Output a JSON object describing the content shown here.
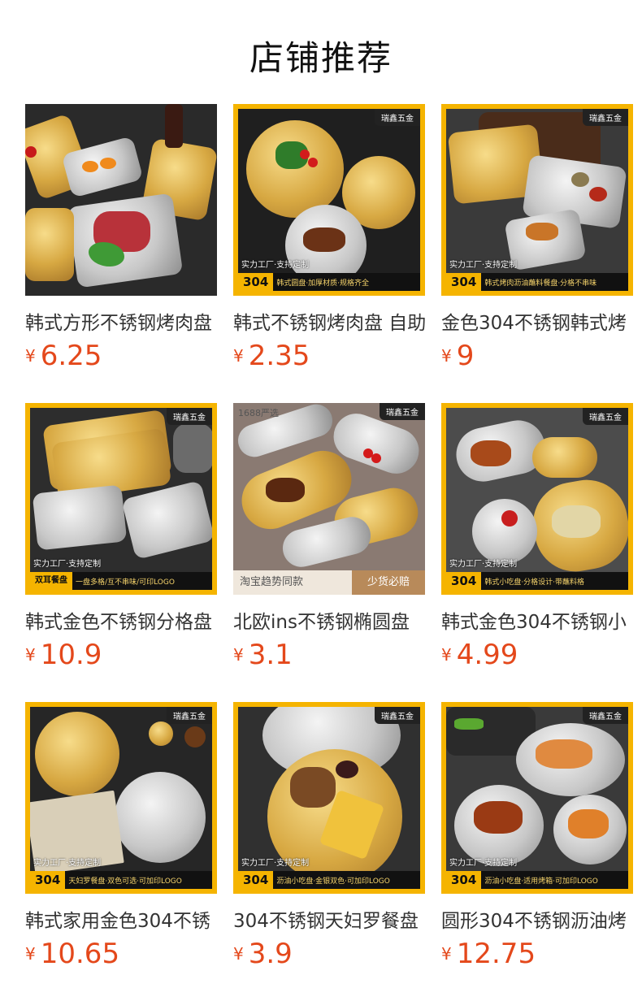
{
  "page": {
    "title": "店铺推荐"
  },
  "products": [
    {
      "title": "韩式方形不锈钢烤肉盘",
      "price": "6.25",
      "yen": "¥",
      "framed": false,
      "brand": "",
      "tag_line": "",
      "tag_code": "",
      "tag_desc": ""
    },
    {
      "title": "韩式不锈钢烤肉盘 自助",
      "price": "2.35",
      "yen": "¥",
      "framed": true,
      "brand": "瑞鑫五金",
      "tag_line": "实力工厂·支持定制",
      "tag_code": "304",
      "tag_desc": "韩式圆盘·加厚材质·规格齐全"
    },
    {
      "title": "金色304不锈钢韩式烤",
      "price": "9",
      "yen": "¥",
      "framed": true,
      "brand": "瑞鑫五金",
      "tag_line": "实力工厂·支持定制",
      "tag_code": "304",
      "tag_desc": "韩式烤肉沥油蘸料餐盘·分格不串味"
    },
    {
      "title": "韩式金色不锈钢分格盘",
      "price": "10.9",
      "yen": "¥",
      "framed": true,
      "brand": "瑞鑫五金",
      "tag_line": "实力工厂·支持定制",
      "tag_code": "双耳餐盘",
      "tag_desc": "一盘多格/互不串味/可印LOGO"
    },
    {
      "title": "北欧ins不锈钢椭圆盘",
      "price": "3.1",
      "yen": "¥",
      "framed": false,
      "brand": "瑞鑫五金",
      "tag_line": "",
      "tag_code": "",
      "tag_desc": "",
      "corner": "1688严选",
      "ribbon_left": "淘宝趋势同款",
      "ribbon_right": "少货必赔"
    },
    {
      "title": "韩式金色304不锈钢小",
      "price": "4.99",
      "yen": "¥",
      "framed": true,
      "brand": "瑞鑫五金",
      "tag_line": "实力工厂·支持定制",
      "tag_code": "304",
      "tag_desc": "韩式小吃盘·分格设计·带蘸料格"
    },
    {
      "title": "韩式家用金色304不锈",
      "price": "10.65",
      "yen": "¥",
      "framed": true,
      "brand": "瑞鑫五金",
      "tag_line": "实力工厂·支持定制",
      "tag_code": "304",
      "tag_desc": "天妇罗餐盘·双色可选·可加印LOGO"
    },
    {
      "title": "304不锈钢天妇罗餐盘",
      "price": "3.9",
      "yen": "¥",
      "framed": true,
      "brand": "瑞鑫五金",
      "tag_line": "实力工厂·支持定制",
      "tag_code": "304",
      "tag_desc": "沥油小吃盘·金银双色·可加印LOGO"
    },
    {
      "title": "圆形304不锈钢沥油烤",
      "price": "12.75",
      "yen": "¥",
      "framed": true,
      "brand": "瑞鑫五金",
      "tag_line": "实力工厂·支持定制",
      "tag_code": "304",
      "tag_desc": "沥油小吃盘·适用烤箱·可加印LOGO"
    }
  ]
}
